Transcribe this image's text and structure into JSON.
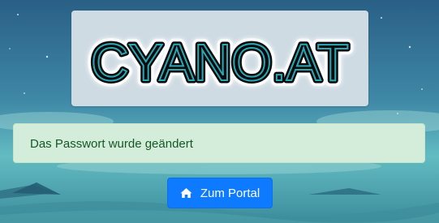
{
  "logo": {
    "text": "CYANO.AT"
  },
  "alert": {
    "message": "Das Passwort wurde geändert"
  },
  "portal_button": {
    "label": "Zum Portal",
    "icon": "home-icon"
  },
  "colors": {
    "alert_bg": "#d4edda",
    "alert_text": "#155724",
    "button_bg": "#0d7aff",
    "logo_stroke": "#0a0a0a",
    "logo_fill": "#2aa7b5"
  }
}
